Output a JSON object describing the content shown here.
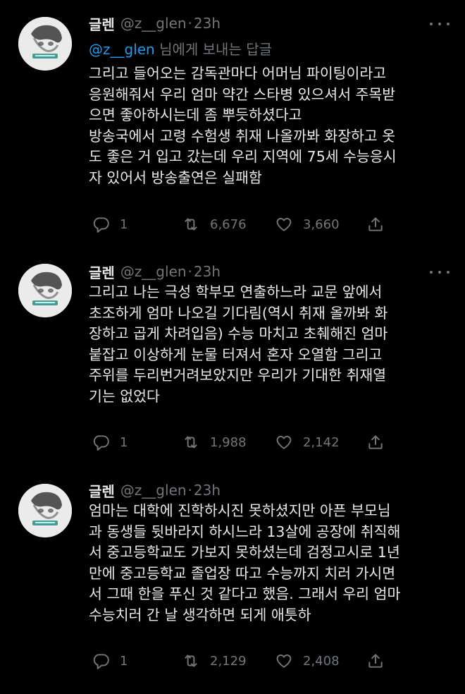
{
  "tweets": [
    {
      "name": "글렌",
      "handle": "@z__glen",
      "dot": "·",
      "time": "23h",
      "reply_mention": "@z__glen",
      "reply_suffix": "님에게 보내는 답글",
      "lines": [
        "그리고 들어오는 감독관마다 어머님 파이팅이라고",
        "응원해줘서 우리 엄마 약간 스타병 있으셔서 주목받",
        "으면 좋아하시는데 좀 뿌듯하셨다고",
        "방송국에서 고령 수험생 취재 나올까봐 화장하고 옷",
        "도 좋은 거 입고 갔는데 우리 지역에 75세 수능응시",
        "자 있어서 방송출연은 실패함"
      ],
      "replies": "1",
      "retweets": "6,676",
      "likes": "3,660"
    },
    {
      "name": "글렌",
      "handle": "@z__glen",
      "dot": "·",
      "time": "23h",
      "lines": [
        "그리고 나는 극성 학부모 연출하느라 교문 앞에서",
        "초조하게 엄마 나오길 기다림(역시 취재 올까봐 화",
        "장하고 곱게 차려입음) 수능 마치고 초췌해진 엄마",
        "붙잡고 이상하게 눈물 터져서 혼자 오열함 그리고",
        "주위를 두리번거려보았지만 우리가 기대한 취재열",
        "기는 없었다"
      ],
      "replies": "1",
      "retweets": "1,988",
      "likes": "2,142"
    },
    {
      "name": "글렌",
      "handle": "@z__glen",
      "dot": "·",
      "time": "23h",
      "lines": [
        "엄마는 대학에 진학하시진 못하셨지만 아픈 부모님",
        "과 동생들 뒷바라지 하시느라 13살에 공장에 취직해",
        "서 중고등학교도 가보지 못하셨는데 검정고시로 1년",
        "만에 중고등학교 졸업장 따고 수능까지 치러 가시면",
        "서 그때 한을 푸신 것 같다고 했음. 그래서 우리 엄마",
        "수능치러 간 날 생각하면 되게 애틋하"
      ],
      "replies": "1",
      "retweets": "2,129",
      "likes": "2,408"
    }
  ],
  "icons": {
    "reply": "reply-icon",
    "retweet": "retweet-icon",
    "like": "heart-icon",
    "share": "share-icon",
    "more": "more-icon"
  },
  "colors": {
    "background": "#000000",
    "text": "#e7e9ea",
    "muted": "#71767b",
    "mention": "#1d9bf0"
  }
}
